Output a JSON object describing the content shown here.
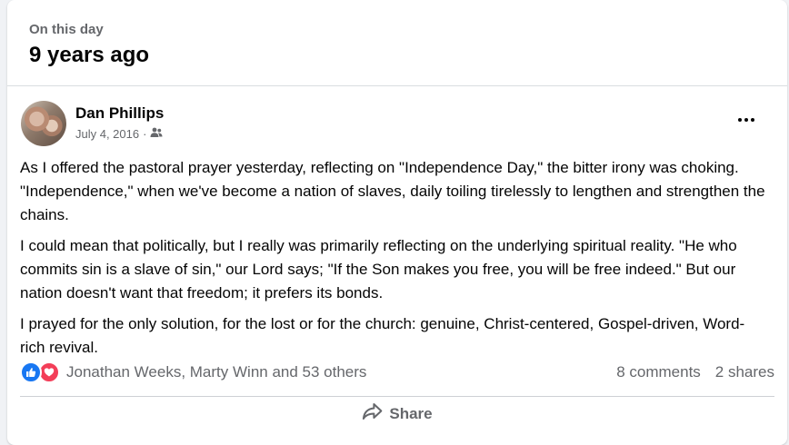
{
  "memory": {
    "subtitle": "On this day",
    "title": "9 years ago"
  },
  "post": {
    "author": "Dan Phillips",
    "date": "July 4, 2016",
    "separator": "·",
    "audience_icon": "friends-icon",
    "paragraphs": [
      "As I offered the pastoral prayer yesterday, reflecting on \"Independence Day,\" the bitter irony was choking. \"Independence,\" when we've become a nation of slaves, daily toiling tirelessly to lengthen and strengthen the chains.",
      "I could mean that politically, but I really was primarily reflecting on the underlying spiritual reality. \"He who commits sin is a slave of sin,\" our Lord says; \"If the Son makes you free, you will be free indeed.\" But our nation doesn't want that freedom; it prefers its bonds.",
      "I prayed for the only solution, for the lost or for the church: genuine, Christ-centered, Gospel-driven, Word-rich revival."
    ]
  },
  "reactions": {
    "icons": [
      "like-icon",
      "love-icon"
    ],
    "summary": "Jonathan Weeks, Marty Winn and 53 others",
    "comments": "8 comments",
    "shares": "2 shares"
  },
  "actions": {
    "share_label": "Share",
    "share_icon": "share-arrow-icon"
  },
  "colors": {
    "like": "#1877f2",
    "love": "#f33e58",
    "secondary_text": "#65676b"
  }
}
